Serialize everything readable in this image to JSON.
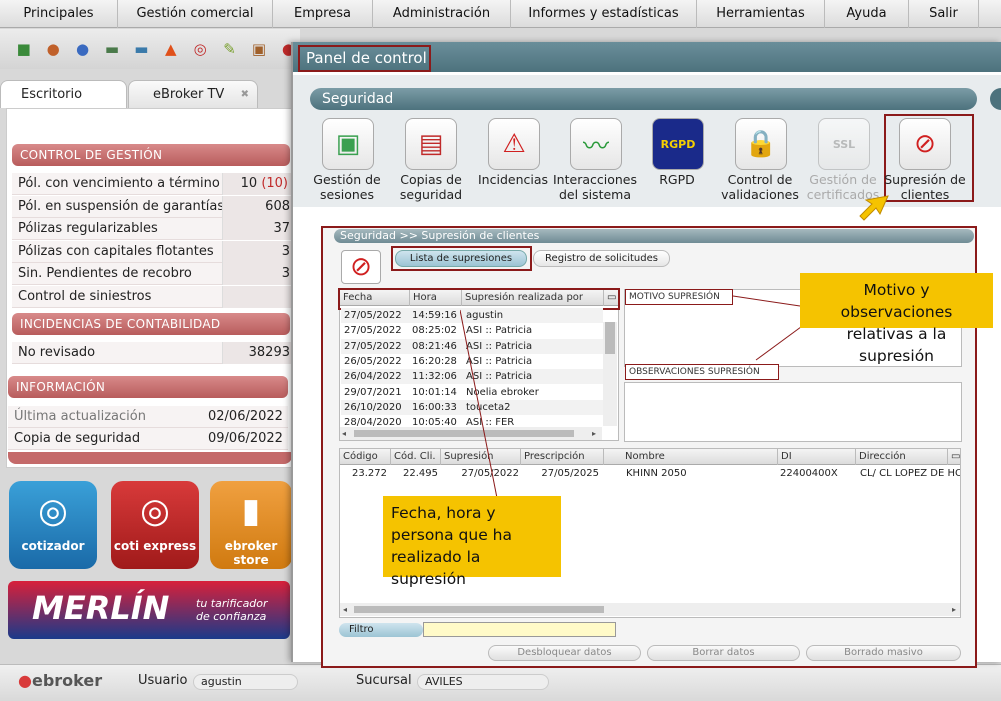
{
  "menu": [
    "Principales",
    "Gestión comercial",
    "Empresa",
    "Administración",
    "Informes y estadísticas",
    "Herramientas",
    "Ayuda",
    "Salir"
  ],
  "tabs": {
    "escritorio": "Escritorio",
    "ebroker_tv": "eBroker TV"
  },
  "control_gestion": {
    "title": "CONTROL DE GESTIÓN",
    "rows": [
      {
        "label": "Pól. con vencimiento a término",
        "value": "10",
        "extra": "(10)"
      },
      {
        "label": "Pól. en suspensión de garantías",
        "value": "608",
        "extra": ""
      },
      {
        "label": "Pólizas regularizables",
        "value": "37",
        "extra": ""
      },
      {
        "label": "Pólizas con capitales flotantes",
        "value": "3",
        "extra": ""
      },
      {
        "label": "Sin. Pendientes de recobro",
        "value": "3",
        "extra": ""
      },
      {
        "label": "Control de siniestros",
        "value": "",
        "extra": ""
      }
    ]
  },
  "incidencias": {
    "title": "INCIDENCIAS DE CONTABILIDAD",
    "rows": [
      {
        "label": "No revisado",
        "value": "38293"
      }
    ]
  },
  "informacion": {
    "title": "INFORMACIÓN",
    "rows": [
      {
        "label": "Última actualización",
        "value": "02/06/2022"
      },
      {
        "label": "Copia de seguridad",
        "value": "09/06/2022"
      }
    ]
  },
  "tiles": {
    "cotizador": "cotizador",
    "coti_express": "coti express",
    "store": "ebroker store"
  },
  "merlin": {
    "name": "MERLÍN",
    "tagline1": "tu tarificador",
    "tagline2": "de confianza"
  },
  "status": {
    "brand": "ebroker",
    "user_label": "Usuario",
    "user_value": "agustin",
    "branch_label": "Sucursal",
    "branch_value": "AVILES"
  },
  "panel": {
    "title": "Panel de control",
    "section": "Seguridad",
    "icons": [
      {
        "label1": "Gestión de",
        "label2": "sesiones"
      },
      {
        "label1": "Copias de",
        "label2": "seguridad"
      },
      {
        "label1": "Incidencias",
        "label2": ""
      },
      {
        "label1": "Interacciones",
        "label2": "del sistema"
      },
      {
        "label1": "RGPD",
        "label2": "",
        "badge": "RGPD"
      },
      {
        "label1": "Control de",
        "label2": "validaciones"
      },
      {
        "label1": "Gestión de",
        "label2": "certificados",
        "badge": "SSL"
      },
      {
        "label1": "Supresión de",
        "label2": "clientes"
      }
    ]
  },
  "sub": {
    "breadcrumb": "Seguridad >> Supresión de clientes",
    "tab_active": "Lista de supresiones",
    "tab_other": "Registro de solicitudes",
    "list_headers": [
      "Fecha",
      "Hora",
      "Supresión realizada por"
    ],
    "list_rows": [
      [
        "27/05/2022",
        "14:59:16",
        "agustin"
      ],
      [
        "27/05/2022",
        "08:25:02",
        "ASI :: Patricia"
      ],
      [
        "27/05/2022",
        "08:21:46",
        "ASI :: Patricia"
      ],
      [
        "26/05/2022",
        "16:20:28",
        "ASI :: Patricia"
      ],
      [
        "26/04/2022",
        "11:32:06",
        "ASI :: Patricia"
      ],
      [
        "29/07/2021",
        "10:01:14",
        "Noelia ebroker"
      ],
      [
        "26/10/2020",
        "16:00:33",
        "touceta2"
      ],
      [
        "28/04/2020",
        "10:05:40",
        "ASI :: FER"
      ]
    ],
    "motivo_label": "MOTIVO SUPRESIÓN",
    "obs_label": "OBSERVACIONES SUPRESIÓN",
    "grid_headers": [
      "Código",
      "Cód. Cli.",
      "Supresión",
      "Prescripción",
      "Nombre",
      "DI",
      "Dirección"
    ],
    "grid_row": [
      "23.272",
      "22.495",
      "27/05/2022",
      "27/05/2025",
      "KHINN 2050",
      "22400400X",
      "CL/ CL LOPEZ DE HO"
    ],
    "filtro": "Filtro",
    "buttons": [
      "Desbloquear datos",
      "Borrar datos",
      "Borrado masivo"
    ]
  },
  "callouts": {
    "motivo": "Motivo y observaciones relativas a la supresión",
    "fecha": "Fecha, hora y persona que ha realizado la supresión"
  },
  "colors": {
    "accent": "#b85c5c",
    "panel": "#4d727d",
    "callout": "#f5c300",
    "annotation": "#8b1a1a"
  }
}
